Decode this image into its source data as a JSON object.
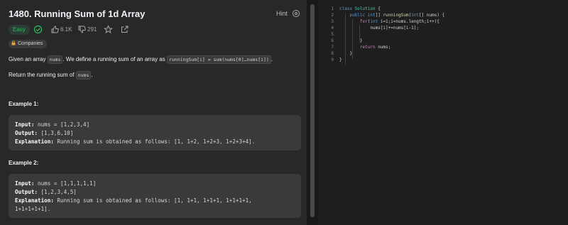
{
  "problem": {
    "title": "1480. Running Sum of 1d Array",
    "hint_label": "Hint",
    "difficulty": "Easy",
    "likes": "6.1K",
    "dislikes": "291",
    "companies_label": "Companies"
  },
  "description": {
    "p1_a": "Given an array ",
    "p1_code1": "nums",
    "p1_b": ". We define a running sum of an array as ",
    "p1_code2": "runningSum[i] = sum(nums[0]…nums[i])",
    "p1_c": ".",
    "p2_a": "Return the running sum of ",
    "p2_code": "nums",
    "p2_b": "."
  },
  "examples": [
    {
      "title": "Example 1:",
      "input_label": "Input:",
      "input_value": " nums = [1,2,3,4]",
      "output_label": "Output:",
      "output_value": " [1,3,6,10]",
      "explanation_label": "Explanation:",
      "explanation_value": " Running sum is obtained as follows: [1, 1+2, 1+2+3, 1+2+3+4]."
    },
    {
      "title": "Example 2:",
      "input_label": "Input:",
      "input_value": " nums = [1,1,1,1,1]",
      "output_label": "Output:",
      "output_value": " [1,2,3,4,5]",
      "explanation_label": "Explanation:",
      "explanation_value": " Running sum is obtained as follows: [1, 1+1, 1+1+1, 1+1+1+1,",
      "explanation_value2": "1+1+1+1+1]."
    }
  ],
  "editor": {
    "line_numbers": [
      "1",
      "2",
      "3",
      "4",
      "5",
      "6",
      "7",
      "8",
      "9"
    ],
    "l1": {
      "kw": "class",
      "name": " Solution",
      "rest": " {"
    },
    "l2": {
      "indent": "    ",
      "kw": "public",
      "t1": " int",
      "rest1": "[] ",
      "fn": "runningSum",
      "rest2": "(",
      "t2": "int",
      "rest3": "[] nums) {"
    },
    "l3": {
      "indent": "        ",
      "kw": "for",
      "rest1": "(",
      "t1": "int",
      "rest2": " i=1;i<nums.length;i++){"
    },
    "l4": {
      "indent": "            ",
      "text": "nums[i]+=nums[i-1];"
    },
    "l5": {
      "text": ""
    },
    "l6": {
      "indent": "        ",
      "text": "}"
    },
    "l7": {
      "indent": "        ",
      "kw": "return",
      "rest": " nums;"
    },
    "l8": {
      "indent": "    ",
      "text": "}"
    },
    "l9": {
      "text": "}"
    }
  },
  "colors": {
    "easy": "#2cbb5d",
    "keyword": "#569cd6",
    "type": "#4ec9b0",
    "function": "#dcdcaa"
  }
}
